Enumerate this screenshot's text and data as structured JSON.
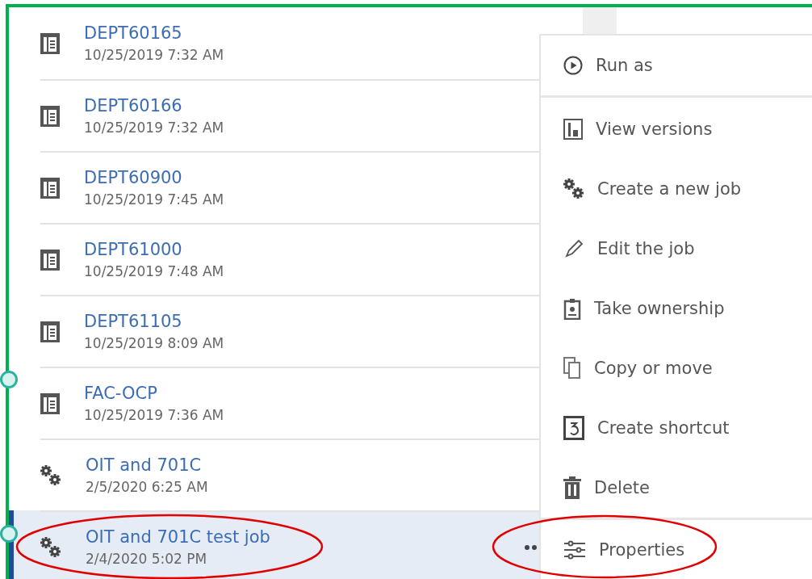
{
  "rows": [
    {
      "kind": "report",
      "name": "DEPT60165",
      "date": "10/25/2019 7:32 AM",
      "selected": false,
      "circled": false
    },
    {
      "kind": "report",
      "name": "DEPT60166",
      "date": "10/25/2019 7:32 AM",
      "selected": false,
      "circled": false
    },
    {
      "kind": "report",
      "name": "DEPT60900",
      "date": "10/25/2019 7:45 AM",
      "selected": false,
      "circled": false
    },
    {
      "kind": "report",
      "name": "DEPT61000",
      "date": "10/25/2019 7:48 AM",
      "selected": false,
      "circled": false
    },
    {
      "kind": "report",
      "name": "DEPT61105",
      "date": "10/25/2019 8:09 AM",
      "selected": false,
      "circled": false
    },
    {
      "kind": "report",
      "name": "FAC-OCP",
      "date": "10/25/2019 7:36 AM",
      "selected": false,
      "circled": false
    },
    {
      "kind": "job",
      "name": "OIT and 701C",
      "date": "2/5/2020 6:25 AM",
      "selected": false,
      "circled": false
    },
    {
      "kind": "job",
      "name": "OIT and 701C test job",
      "date": "2/4/2020 5:02 PM",
      "selected": true,
      "circled": true
    }
  ],
  "context_menu": {
    "groups": [
      [
        {
          "label": "Run as",
          "circled": false
        }
      ],
      [
        {
          "label": "View versions",
          "circled": false
        },
        {
          "label": "Create a new job",
          "circled": false
        },
        {
          "label": "Edit the job",
          "circled": false
        },
        {
          "label": "Take ownership",
          "circled": false
        },
        {
          "label": "Copy or move",
          "circled": false
        },
        {
          "label": "Create shortcut",
          "circled": false
        },
        {
          "label": "Delete",
          "circled": false
        }
      ],
      [
        {
          "label": "Properties",
          "circled": true
        }
      ]
    ]
  }
}
